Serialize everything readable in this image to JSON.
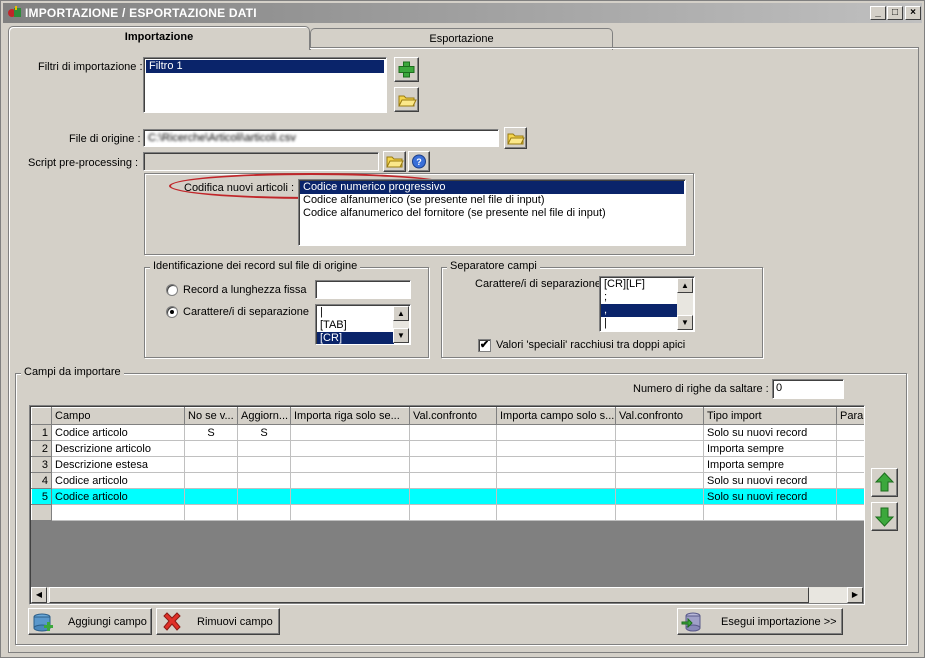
{
  "window": {
    "title": "IMPORTAZIONE / ESPORTAZIONE DATI",
    "min": "_",
    "max": "□",
    "close": "×"
  },
  "tabs": [
    {
      "label": "Importazione"
    },
    {
      "label": "Esportazione"
    }
  ],
  "import": {
    "filters_label": "Filtri di importazione :",
    "filters": [
      "Filtro 1"
    ],
    "source_label": "File di origine :",
    "source_value": "C:\\Ricerche\\Articoli\\articoli.csv",
    "script_label": "Script pre-processing :",
    "script_value": "",
    "codifica_label": "Codifica nuovi articoli :",
    "codifica_options": [
      "Codice numerico progressivo",
      "Codice alfanumerico (se presente nel file di input)",
      "Codice alfanumerico del fornitore (se presente nel file di input)"
    ],
    "ident_group": "Identificazione dei record sul file di origine",
    "radio_fixed": "Record a lunghezza fissa",
    "radio_sep": "Carattere/i di separazione",
    "fixed_value": "",
    "sep_list": [
      "|",
      "[TAB]",
      "[CR]"
    ],
    "sep_group": "Separatore campi",
    "field_sep_label": "Carattere/i di separazione",
    "field_sep_list": [
      "[CR][LF]",
      ";",
      ",",
      "|"
    ],
    "quotes_label": "Valori 'speciali' racchiusi tra doppi apici",
    "quotes_checked": "✔"
  },
  "fields": {
    "group_title": "Campi da importare",
    "skip_label": "Numero di righe da saltare  :",
    "skip_value": "0",
    "columns": [
      "",
      "Campo",
      "No se v...",
      "Aggiorn...",
      "Importa riga solo se...",
      "Val.confronto",
      "Importa campo solo s...",
      "Val.confronto",
      "Tipo import",
      "Param"
    ],
    "rows": [
      {
        "n": "1",
        "campo": "Codice articolo",
        "nosev": "S",
        "aggiorn": "S",
        "tipo": "Solo su nuovi record"
      },
      {
        "n": "2",
        "campo": "Descrizione articolo",
        "nosev": "",
        "aggiorn": "",
        "tipo": "Importa sempre"
      },
      {
        "n": "3",
        "campo": "Descrizione estesa",
        "nosev": "",
        "aggiorn": "",
        "tipo": "Importa sempre"
      },
      {
        "n": "4",
        "campo": "Codice articolo",
        "nosev": "",
        "aggiorn": "",
        "tipo": "Solo su nuovi record"
      },
      {
        "n": "5",
        "campo": "Codice articolo",
        "nosev": "",
        "aggiorn": "",
        "tipo": "Solo su nuovi record"
      }
    ]
  },
  "buttons": {
    "add_field": "Aggiungi campo",
    "remove_field": "Rimuovi campo",
    "run_import": "Esegui importazione >>"
  },
  "colors": {
    "selection": "#0a246a",
    "highlight_row": "#00ffff",
    "accent_oval": "#c0262a"
  }
}
